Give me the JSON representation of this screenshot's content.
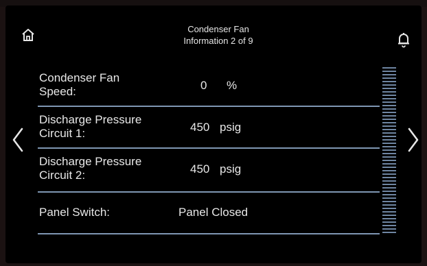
{
  "header": {
    "title_line1": "Condenser Fan",
    "title_line2": "Information 2 of 9"
  },
  "icons": {
    "home": "home-icon",
    "notifications": "bell-icon",
    "previous": "chevron-left-icon",
    "next": "chevron-right-icon"
  },
  "rows": [
    {
      "label_line1": "Condenser Fan",
      "label_line2": "Speed:",
      "value": "0",
      "unit": "%"
    },
    {
      "label_line1": "Discharge Pressure",
      "label_line2": "Circuit 1:",
      "value": "450",
      "unit": "psig"
    },
    {
      "label_line1": "Discharge Pressure",
      "label_line2": "Circuit 2:",
      "value": "450",
      "unit": "psig"
    },
    {
      "label_line1": "Panel Switch:",
      "label_line2": "",
      "value": "Panel Closed",
      "unit": ""
    }
  ],
  "colors": {
    "background": "#000000",
    "text": "#e8e8e8",
    "divider": "#7f97b3"
  }
}
